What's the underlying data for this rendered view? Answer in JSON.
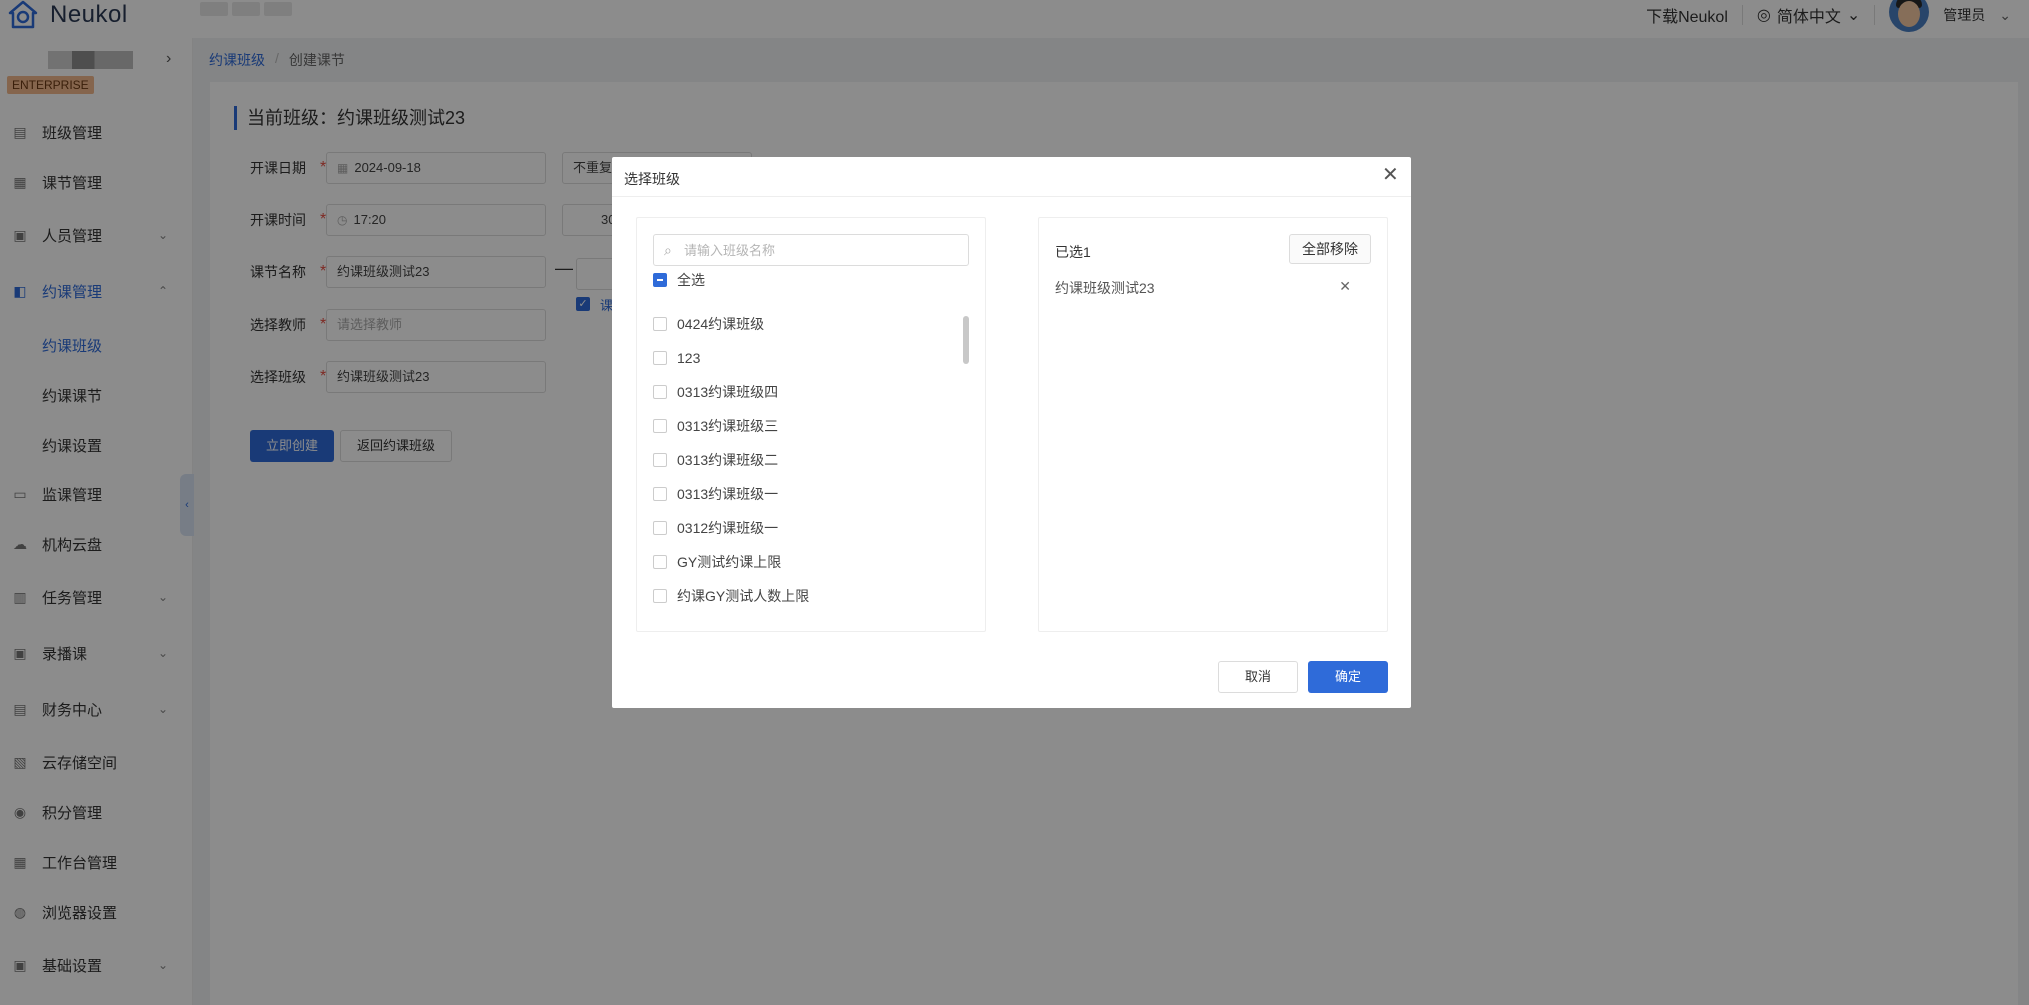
{
  "app": {
    "name": "Neukol"
  },
  "header": {
    "download": "下载Neukol",
    "language": "简体中文",
    "user": "管理员"
  },
  "sidebar": {
    "badge": "ENTERPRISE",
    "items": [
      {
        "label": "班级管理",
        "icon": "class-icon"
      },
      {
        "label": "课节管理",
        "icon": "lesson-icon"
      },
      {
        "label": "人员管理",
        "icon": "people-icon"
      },
      {
        "label": "约课管理",
        "icon": "booking-icon"
      },
      {
        "label": "监课管理",
        "icon": "monitor-icon"
      },
      {
        "label": "机构云盘",
        "icon": "cloud-icon"
      },
      {
        "label": "任务管理",
        "icon": "task-icon"
      },
      {
        "label": "录播课",
        "icon": "record-icon"
      },
      {
        "label": "财务中心",
        "icon": "finance-icon"
      },
      {
        "label": "云存储空间",
        "icon": "storage-icon"
      },
      {
        "label": "积分管理",
        "icon": "points-icon"
      },
      {
        "label": "工作台管理",
        "icon": "workbench-icon"
      },
      {
        "label": "浏览器设置",
        "icon": "browser-icon"
      },
      {
        "label": "基础设置",
        "icon": "settings-icon"
      }
    ],
    "sub_items": [
      "约课班级",
      "约课课节",
      "约课设置"
    ]
  },
  "breadcrumb": {
    "parent": "约课班级",
    "sep": "/",
    "current": "创建课节"
  },
  "form": {
    "title": "当前班级：约课班级测试23",
    "req": "*",
    "date_label": "开课日期",
    "date_value": "2024-09-18",
    "repeat_value": "不重复",
    "time_label": "开课时间",
    "time_value": "17:20",
    "duration_partial": "30",
    "name_label": "课节名称",
    "name_value": "约课班级测试23",
    "dash": "—",
    "lesson_check_partial": "课",
    "teacher_label": "选择教师",
    "teacher_placeholder": "请选择教师",
    "class_label": "选择班级",
    "class_value": "约课班级测试23",
    "create_button": "立即创建",
    "back_button": "返回约课班级"
  },
  "modal": {
    "title": "选择班级",
    "search_placeholder": "请输入班级名称",
    "select_all": "全选",
    "options": [
      "0424约课班级",
      "123",
      "0313约课班级四",
      "0313约课班级三",
      "0313约课班级二",
      "0313约课班级一",
      "0312约课班级一",
      "GY测试约课上限",
      "约课GY测试人数上限"
    ],
    "selected_count": "已选1",
    "remove_all": "全部移除",
    "selected_items": [
      "约课班级测试23"
    ],
    "cancel": "取消",
    "confirm": "确定"
  }
}
